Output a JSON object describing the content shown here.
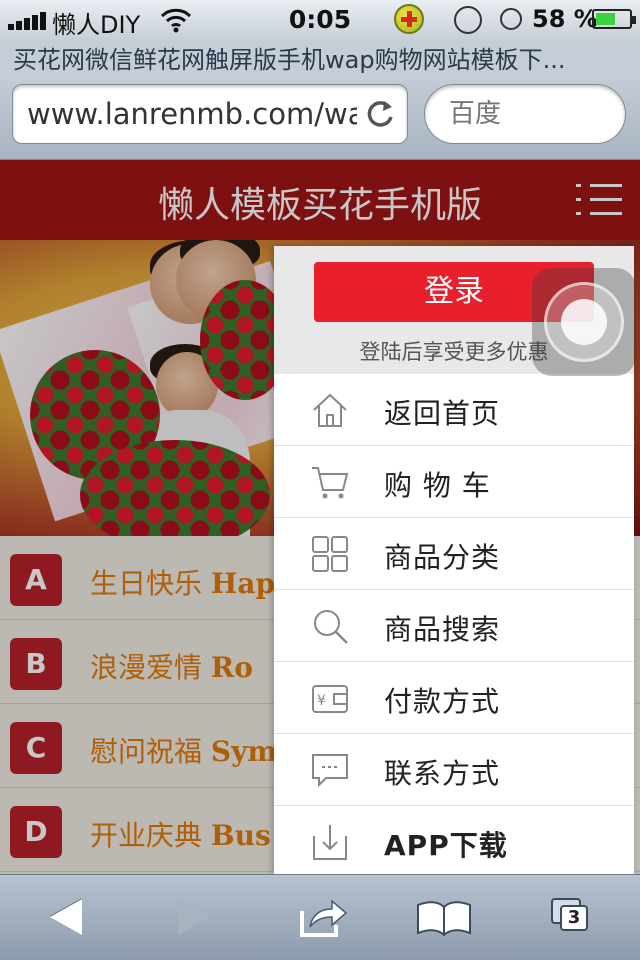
{
  "status_bar": {
    "carrier": "懒人DIY",
    "time": "0:05",
    "battery_percent": "58 %",
    "battery_level": 0.58
  },
  "browser": {
    "page_title": "买花网微信鲜花网触屏版手机wap购物网站模板下...",
    "url": "www.lanrenmb.com/wap",
    "search_placeholder": "百度",
    "tab_count": "3"
  },
  "site": {
    "header_title": "懒人模板买花手机版",
    "categories": [
      {
        "letter": "A",
        "cn": "生日快乐",
        "en": "Hap"
      },
      {
        "letter": "B",
        "cn": "浪漫爱情",
        "en": "Ro"
      },
      {
        "letter": "C",
        "cn": "慰问祝福",
        "en": "Sym"
      },
      {
        "letter": "D",
        "cn": "开业庆典",
        "en": "Bus"
      }
    ]
  },
  "menu": {
    "login_label": "登录",
    "login_tip": "登陆后享受更多优惠",
    "items": [
      {
        "label": "返回首页",
        "icon": "home-icon"
      },
      {
        "label": "购 物 车",
        "icon": "cart-icon"
      },
      {
        "label": "商品分类",
        "icon": "grid-icon"
      },
      {
        "label": "商品搜索",
        "icon": "search-icon"
      },
      {
        "label": "付款方式",
        "icon": "wallet-icon"
      },
      {
        "label": "联系方式",
        "icon": "chat-icon"
      },
      {
        "label": "APP下载",
        "icon": "download-icon"
      }
    ]
  },
  "colors": {
    "brand_red": "#a11517",
    "button_red": "#e8202c",
    "category_text": "#e07a0b"
  }
}
